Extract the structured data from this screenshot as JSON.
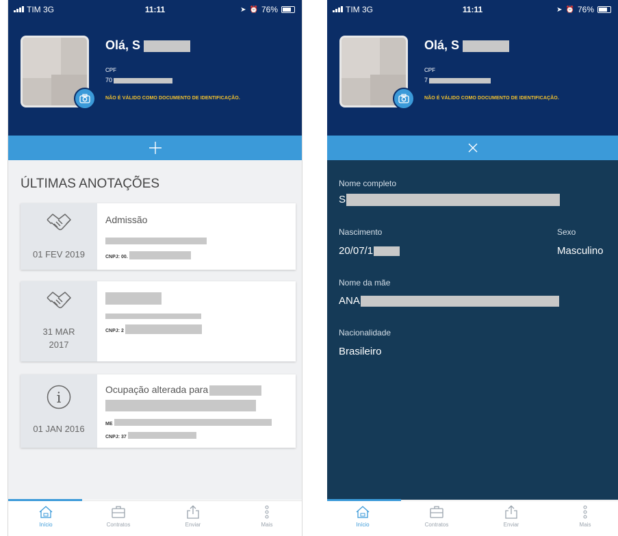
{
  "status_bar": {
    "carrier": "TIM  3G",
    "time": "11:11",
    "battery": "76%"
  },
  "profile": {
    "greeting": "Olá, S",
    "greeting_right": "Olá, S",
    "cpf_label": "CPF",
    "cpf_value": "70",
    "cpf_value_right": "7",
    "warning": "NÃO É VÁLIDO COMO DOCUMENTO DE IDENTIFICAÇÃO."
  },
  "toggle": {
    "expand_symbol": "+",
    "collapse_symbol": "✕"
  },
  "annotations": {
    "section_title": "ÚLTIMAS ANOTAÇÕES",
    "cards": [
      {
        "date_line1": "01 FEV 2019",
        "date_line2": "",
        "title": "Admissão",
        "cnpj": "CNPJ: 00.",
        "icon": "handshake-icon"
      },
      {
        "date_line1": "31 MAR",
        "date_line2": "2017",
        "title": "",
        "cnpj": "CNPJ: 2",
        "icon": "handshake-icon"
      },
      {
        "date_line1": "01 JAN 2016",
        "date_line2": "",
        "title": "Ocupação alterada para",
        "subtitle": "ME",
        "cnpj": "CNPJ: 37",
        "icon": "info-icon"
      }
    ]
  },
  "details": {
    "full_name_label": "Nome completo",
    "full_name_value": "S",
    "birth_label": "Nascimento",
    "birth_value": "20/07/1",
    "sex_label": "Sexo",
    "sex_value": "Masculino",
    "mother_label": "Nome da mãe",
    "mother_value": "ANA",
    "nationality_label": "Nacionalidade",
    "nationality_value": "Brasileiro"
  },
  "nav": {
    "items": [
      {
        "label": "Início",
        "icon": "home-icon"
      },
      {
        "label": "Contratos",
        "icon": "briefcase-icon"
      },
      {
        "label": "Enviar",
        "icon": "share-icon"
      },
      {
        "label": "Mais",
        "icon": "more-icon"
      }
    ]
  },
  "colors": {
    "header": "#0b2d66",
    "accent": "#3b9ad9",
    "details_bg": "#153a57",
    "warning": "#f2c12e"
  }
}
